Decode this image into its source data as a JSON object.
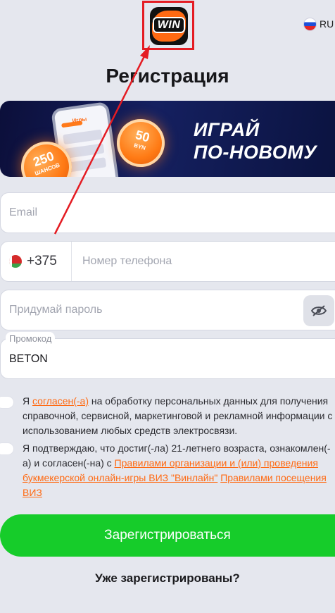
{
  "header": {
    "logo_text": "WIN",
    "language": "RU"
  },
  "page": {
    "title": "Регистрация"
  },
  "banner": {
    "app_title": "Игры",
    "chip1_value": "250",
    "chip1_sub": "ШАНСОВ",
    "chip2_value": "50",
    "chip2_sub": "BYN",
    "slogan_line1": "ИГРАЙ",
    "slogan_line2": "ПО-НОВОМУ"
  },
  "form": {
    "email_placeholder": "Email",
    "phone_code": "+375",
    "phone_placeholder": "Номер телефона",
    "password_placeholder": "Придумай пароль",
    "promo_label": "Промокод",
    "promo_value": "BETON"
  },
  "consent1": {
    "prefix": "Я ",
    "link": "согласен(-а)",
    "text": " на обработку персональных данных для получения справочной, сервисной, маркетинговой и рекламной информации с использованием любых средств электросвязи."
  },
  "consent2": {
    "text": "Я подтверждаю, что достиг(-ла) 21-летнего возраста, ознакомлен(-а) и согласен(-на) с ",
    "link1": "Правилами организации и (или) проведения букмекерской онлайн-игры ВИЗ \"Винлайн\"",
    "link2": "Правилами посещения ВИЗ"
  },
  "actions": {
    "submit_label": "Зарегистрироваться",
    "login_label": "Уже зарегистрированы?"
  },
  "colors": {
    "accent": "#ff6a13",
    "submit": "#16cc2a",
    "annotation": "#e41c23"
  }
}
